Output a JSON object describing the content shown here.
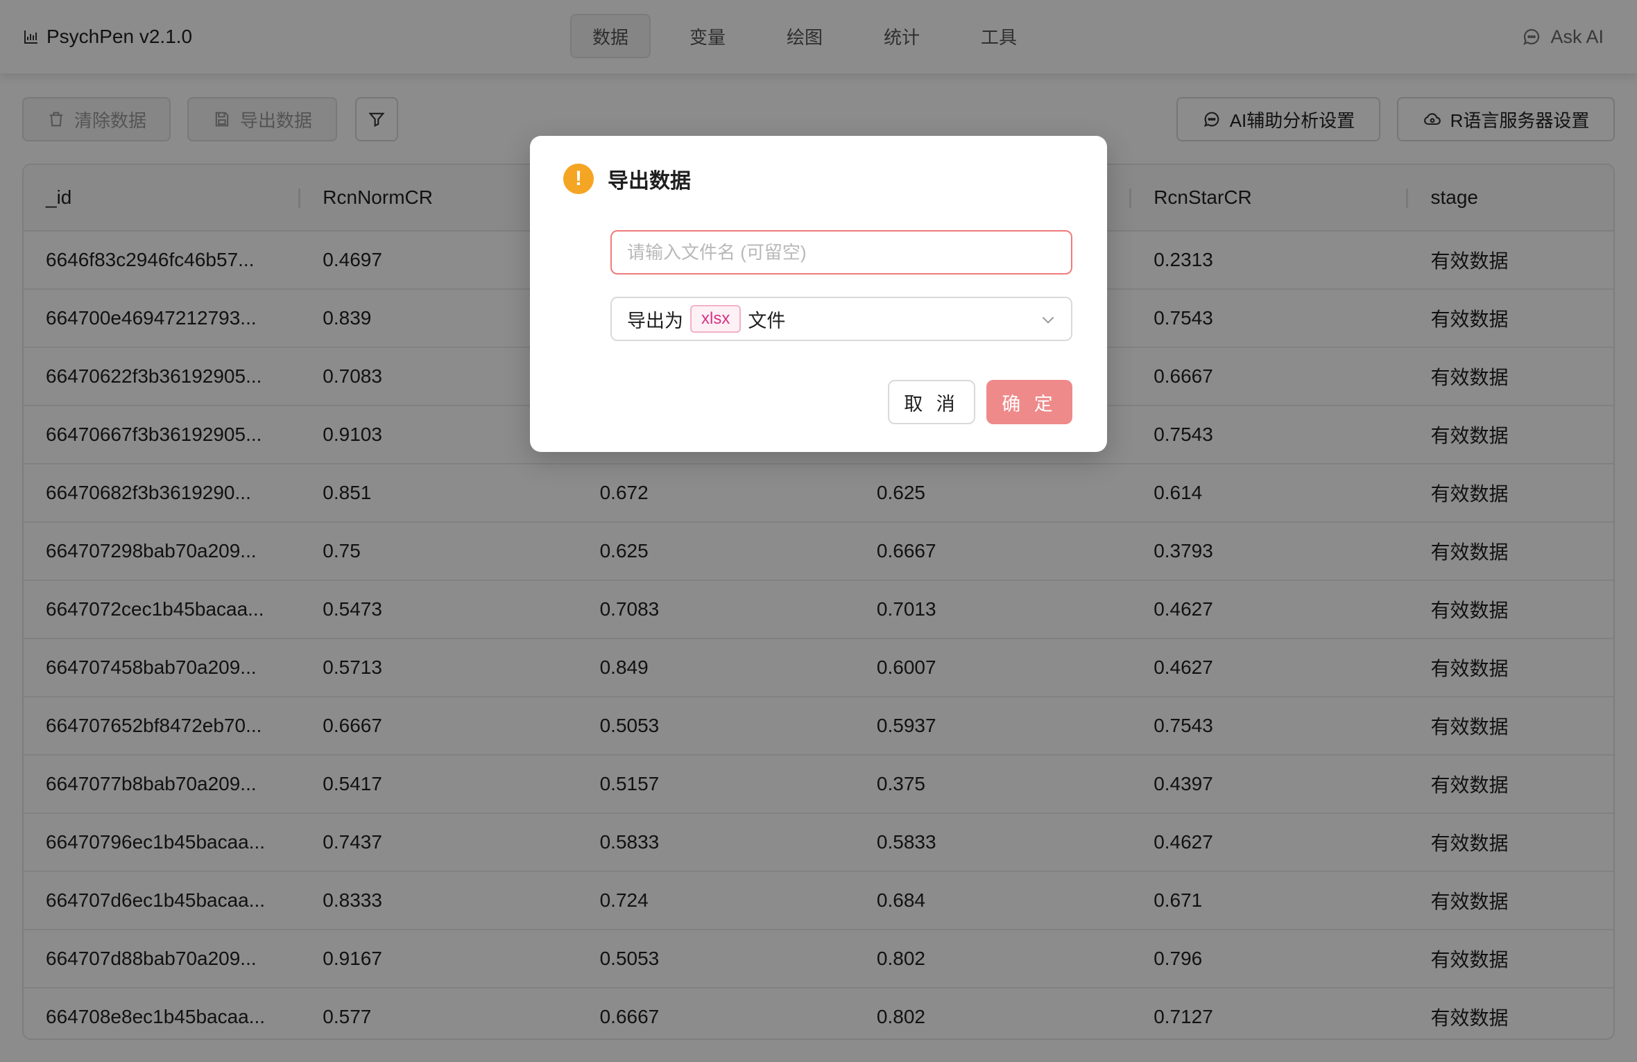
{
  "app": {
    "title": "PsychPen v2.1.0"
  },
  "nav": {
    "tabs": [
      {
        "label": "数据",
        "active": true
      },
      {
        "label": "变量",
        "active": false
      },
      {
        "label": "绘图",
        "active": false
      },
      {
        "label": "统计",
        "active": false
      },
      {
        "label": "工具",
        "active": false
      }
    ],
    "ask_ai": "Ask AI"
  },
  "toolbar": {
    "clear_label": "清除数据",
    "export_label": "导出数据",
    "ai_settings_label": "AI辅助分析设置",
    "r_server_label": "R语言服务器设置"
  },
  "table": {
    "columns": [
      "_id",
      "RcnNormCR",
      "",
      "",
      "RcnStarCR",
      "stage"
    ],
    "rows": [
      [
        "6646f83c2946fc46b57...",
        "0.4697",
        "",
        "",
        "0.2313",
        "有效数据"
      ],
      [
        "664700e46947212793...",
        "0.839",
        "",
        "",
        "0.7543",
        "有效数据"
      ],
      [
        "66470622f3b36192905...",
        "0.7083",
        "",
        "",
        "0.6667",
        "有效数据"
      ],
      [
        "66470667f3b36192905...",
        "0.9103",
        "",
        "",
        "0.7543",
        "有效数据"
      ],
      [
        "66470682f3b3619290...",
        "0.851",
        "0.672",
        "0.625",
        "0.614",
        "有效数据"
      ],
      [
        "664707298bab70a209...",
        "0.75",
        "0.625",
        "0.6667",
        "0.3793",
        "有效数据"
      ],
      [
        "6647072cec1b45bacaa...",
        "0.5473",
        "0.7083",
        "0.7013",
        "0.4627",
        "有效数据"
      ],
      [
        "664707458bab70a209...",
        "0.5713",
        "0.849",
        "0.6007",
        "0.4627",
        "有效数据"
      ],
      [
        "664707652bf8472eb70...",
        "0.6667",
        "0.5053",
        "0.5937",
        "0.7543",
        "有效数据"
      ],
      [
        "6647077b8bab70a209...",
        "0.5417",
        "0.5157",
        "0.375",
        "0.4397",
        "有效数据"
      ],
      [
        "66470796ec1b45bacaa...",
        "0.7437",
        "0.5833",
        "0.5833",
        "0.4627",
        "有效数据"
      ],
      [
        "664707d6ec1b45bacaa...",
        "0.8333",
        "0.724",
        "0.684",
        "0.671",
        "有效数据"
      ],
      [
        "664707d88bab70a209...",
        "0.9167",
        "0.5053",
        "0.802",
        "0.796",
        "有效数据"
      ],
      [
        "664708e8ec1b45bacaa...",
        "0.577",
        "0.6667",
        "0.802",
        "0.7127",
        "有效数据"
      ]
    ]
  },
  "modal": {
    "title": "导出数据",
    "filename_placeholder": "请输入文件名 (可留空)",
    "filename_value": "",
    "format_prefix": "导出为",
    "format_value": "xlsx",
    "format_suffix": "文件",
    "cancel_label": "取 消",
    "ok_label": "确 定"
  },
  "colors": {
    "primary": "#ee8a8a",
    "warning": "#f5a524",
    "tag": "#d63384"
  }
}
